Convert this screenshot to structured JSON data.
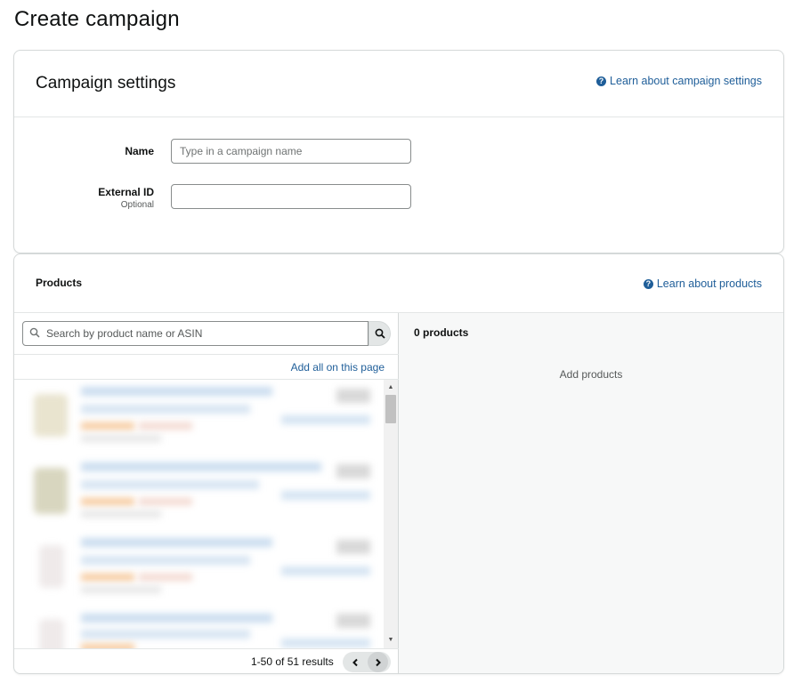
{
  "page": {
    "title": "Create campaign"
  },
  "settings": {
    "title": "Campaign settings",
    "help_link": "Learn about campaign settings",
    "name_label": "Name",
    "name_placeholder": "Type in a campaign name",
    "name_value": "",
    "external_id_label": "External ID",
    "external_id_sub": "Optional",
    "external_id_value": ""
  },
  "products": {
    "title": "Products",
    "help_link": "Learn about products",
    "search_placeholder": "Search by product name or ASIN",
    "add_all": "Add all on this page",
    "results": "1-50 of 51 results",
    "selected_count": "0 products",
    "empty_message": "Add products"
  },
  "icons": {
    "help": "question-circle-icon",
    "search": "magnifier-icon",
    "prev": "chevron-left-icon",
    "next": "chevron-right-icon"
  },
  "colors": {
    "link": "#1f5e99",
    "border": "#d5d9d9",
    "pane_bg": "#f7f8f8"
  }
}
